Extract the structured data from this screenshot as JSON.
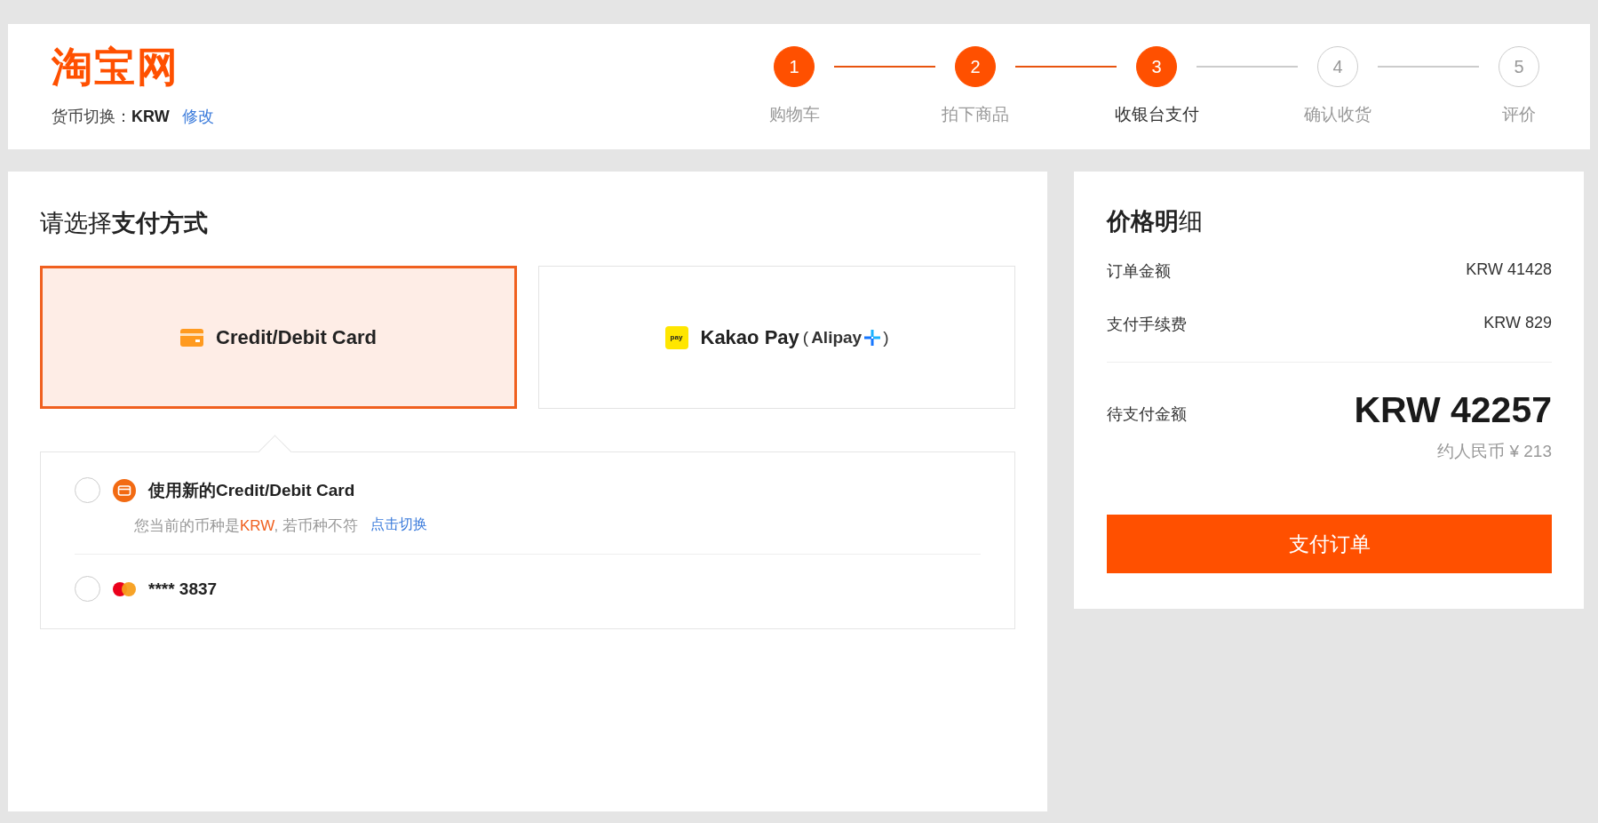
{
  "header": {
    "logo": "淘宝网",
    "currency_label": "货币切换：",
    "currency": "KRW",
    "change_link": "修改"
  },
  "steps": [
    {
      "number": "1",
      "label": "购物车",
      "completed": true,
      "current": false
    },
    {
      "number": "2",
      "label": "拍下商品",
      "completed": true,
      "current": false
    },
    {
      "number": "3",
      "label": "收银台支付",
      "completed": true,
      "current": true
    },
    {
      "number": "4",
      "label": "确认收货",
      "completed": false,
      "current": false
    },
    {
      "number": "5",
      "label": "评价",
      "completed": false,
      "current": false
    }
  ],
  "payment": {
    "title": "请选择**支付方式**",
    "methods": [
      {
        "kind": "card",
        "label": "Credit/Debit Card",
        "selected": true
      },
      {
        "kind": "kakao",
        "label": "Kakao Pay",
        "logo_text": "pay",
        "partner_open": "(",
        "partner": "Alipay",
        "partner_close": ")",
        "selected": false
      }
    ],
    "options": [
      {
        "kind": "new_card",
        "title": "使用新的Credit/Debit Card",
        "note_before": "您当前的币种是",
        "note_currency": "KRW",
        "note_after": ", 若币种不符",
        "link": "点击切换",
        "selected": false
      },
      {
        "kind": "saved_card",
        "title": "**** 3837",
        "selected": false
      }
    ]
  },
  "summary": {
    "title": "**价格明**细",
    "rows": [
      {
        "label": "订单金额",
        "value": "KRW 41428"
      },
      {
        "label": "支付手续费",
        "value": "KRW 829"
      }
    ],
    "total_label": "待支付金额",
    "total_value": "KRW 42257",
    "approx": "约人民币 ¥ 213",
    "pay_button": "支付订单"
  }
}
